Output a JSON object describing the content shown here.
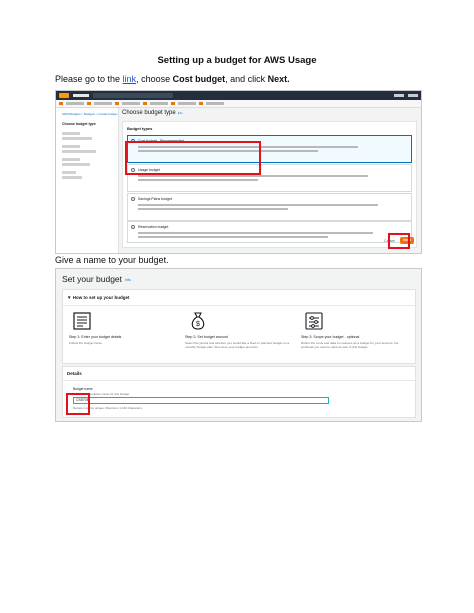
{
  "doc": {
    "title": "Setting up a budget for AWS Usage",
    "instruction1": {
      "prefix": "Please go to the ",
      "link_text": "link",
      "middle1": ", choose ",
      "choice": "Cost budget",
      "middle2": ", and click ",
      "action": "Next",
      "suffix": "."
    },
    "instruction2": "Give a name to your budget."
  },
  "screenshot1": {
    "breadcrumb": "AWS Budgets  >  Budgets  >  Create budget",
    "sidebar_selected": "Choose budget type",
    "heading": "Choose budget type",
    "heading_info": "Info",
    "section_title": "Budget types",
    "options": [
      "Cost budget - Recommended",
      "Usage budget",
      "Savings Plans budget",
      "Reservation budget"
    ],
    "cancel_label": "Cancel",
    "next_label": "Next",
    "accent_color": "#ec7211",
    "highlight_color": "#e3111a"
  },
  "screenshot2": {
    "title": "Set your budget",
    "title_info": "Info",
    "howto_label": "▼  How to set up your budget",
    "steps": [
      {
        "name": "Step 1: Enter your budget details",
        "desc": "Follow the budget name",
        "icon": "document-list-icon"
      },
      {
        "name": "Step 2: Set budget amount",
        "desc": "Select the period and whether you would like a fixed or planned budget on a monthly budget plan. Fine-tune your budget amounts.",
        "icon": "money-bag-icon"
      },
      {
        "name": "Step 3: Scope your budget - optional",
        "desc": "Refine the costs and data to measure as a budget for your account, the workload you want to track as part of this budget.",
        "icon": "sliders-icon"
      }
    ],
    "details_label": "Details",
    "field_label": "Budget name",
    "field_hint": "Provide a descriptive name for this budget.",
    "field_value": "CS570E",
    "field_constraint": "Names must be unique. Maximum 1 100 characters."
  }
}
